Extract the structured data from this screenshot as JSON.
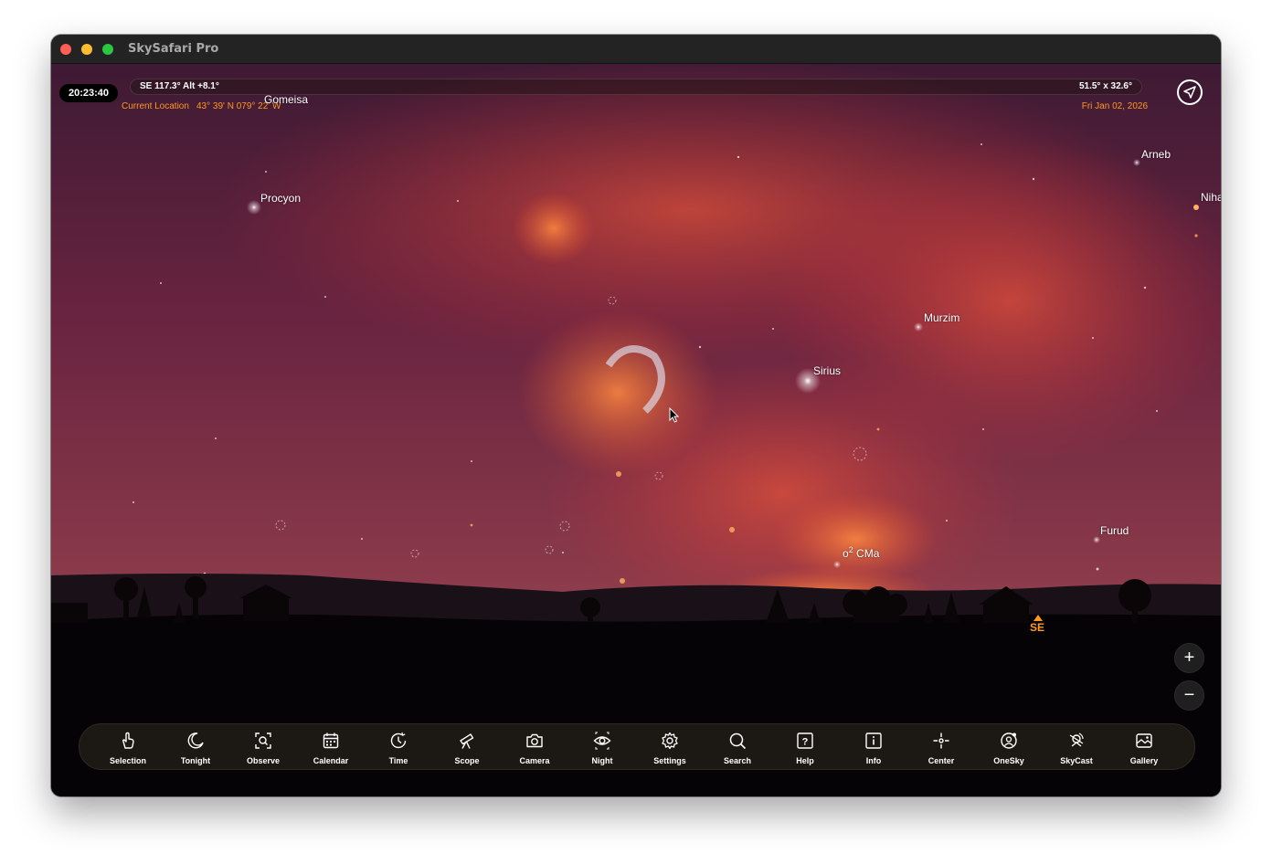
{
  "window": {
    "title": "SkySafari Pro"
  },
  "hud": {
    "clock": "20:23:40",
    "direction_readout": "SE 117.3° Alt +8.1°",
    "field_of_view": "51.5° x 32.6°",
    "location_label": "Current Location",
    "location_coords": "43° 39' N 079° 22' W",
    "date": "Fri Jan 02, 2026"
  },
  "sky_labels": {
    "gomeisa": "Gomeisa",
    "procyon": "Procyon",
    "arneb": "Arneb",
    "nihal": "Niha",
    "murzim": "Murzim",
    "sirius": "Sirius",
    "furud": "Furud",
    "o2cma_prefix": "o",
    "o2cma_sup": "2",
    "o2cma_suffix": " CMa"
  },
  "horizon": {
    "direction": "SE"
  },
  "zoom": {
    "in": "+",
    "out": "−"
  },
  "toolbar": {
    "items": [
      {
        "label": "Selection",
        "icon": "hand-pointer-icon"
      },
      {
        "label": "Tonight",
        "icon": "moon-icon"
      },
      {
        "label": "Observe",
        "icon": "observe-icon"
      },
      {
        "label": "Calendar",
        "icon": "calendar-icon"
      },
      {
        "label": "Time",
        "icon": "clock-icon"
      },
      {
        "label": "Scope",
        "icon": "telescope-icon"
      },
      {
        "label": "Camera",
        "icon": "camera-icon"
      },
      {
        "label": "Night",
        "icon": "eye-icon"
      },
      {
        "label": "Settings",
        "icon": "gear-icon"
      },
      {
        "label": "Search",
        "icon": "search-icon"
      },
      {
        "label": "Help",
        "icon": "help-icon"
      },
      {
        "label": "Info",
        "icon": "info-icon"
      },
      {
        "label": "Center",
        "icon": "crosshair-icon"
      },
      {
        "label": "OneSky",
        "icon": "onesky-icon"
      },
      {
        "label": "SkyCast",
        "icon": "skycast-icon"
      },
      {
        "label": "Gallery",
        "icon": "gallery-icon"
      }
    ]
  },
  "colors": {
    "accent": "#ff9a1f",
    "sky_top": "#3a1830",
    "sky_red": "#b83a3a",
    "toolbar_bg": "#1c1914"
  }
}
